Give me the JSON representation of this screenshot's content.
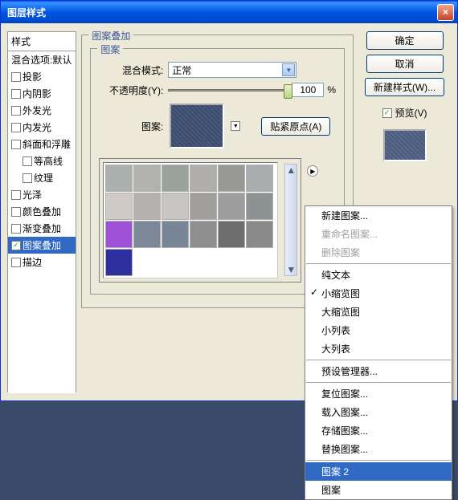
{
  "title": "图层样式",
  "sidebar": {
    "header": "样式",
    "blend_header": "混合选项:默认",
    "items": [
      {
        "label": "投影",
        "checked": false
      },
      {
        "label": "内阴影",
        "checked": false
      },
      {
        "label": "外发光",
        "checked": false
      },
      {
        "label": "内发光",
        "checked": false
      },
      {
        "label": "斜面和浮雕",
        "checked": false
      },
      {
        "label": "等高线",
        "checked": false,
        "indent": true
      },
      {
        "label": "纹理",
        "checked": false,
        "indent": true
      },
      {
        "label": "光泽",
        "checked": false
      },
      {
        "label": "颜色叠加",
        "checked": false
      },
      {
        "label": "渐变叠加",
        "checked": false
      },
      {
        "label": "图案叠加",
        "checked": true,
        "selected": true
      },
      {
        "label": "描边",
        "checked": false
      }
    ]
  },
  "panel": {
    "group_title": "图案叠加",
    "inner_title": "图案",
    "blend_label": "混合模式:",
    "blend_value": "正常",
    "opacity_label": "不透明度(Y):",
    "opacity_value": "100",
    "opacity_unit": "%",
    "pattern_label": "图案:",
    "snap_btn": "贴紧原点(A)"
  },
  "right": {
    "ok": "确定",
    "cancel": "取消",
    "newstyle": "新建样式(W)...",
    "preview": "预览(V)"
  },
  "ctx": {
    "new": "新建图案...",
    "rename": "重命名图案...",
    "delete": "删除图案",
    "text_only": "纯文本",
    "small_thumb": "小缩览图",
    "large_thumb": "大缩览图",
    "small_list": "小列表",
    "large_list": "大列表",
    "preset_mgr": "预设管理器...",
    "reset": "复位图案...",
    "load": "载入图案...",
    "save": "存储图案...",
    "replace": "替换图案...",
    "pat2": "图案 2",
    "pat": "图案"
  },
  "swatch_colors": [
    "#aab0ae",
    "#b2b2ae",
    "#9aa29c",
    "#b0aeab",
    "#999a96",
    "#a9adae",
    "#cfcac6",
    "#b5b2ad",
    "#c9c6c1",
    "#a19f9b",
    "#9e9e9e",
    "#8d9292",
    "#9f52d8",
    "#7c889a",
    "#788696",
    "#8e8e8e",
    "#6e6e6e",
    "#8a8a8a",
    "#2e2e9e"
  ]
}
